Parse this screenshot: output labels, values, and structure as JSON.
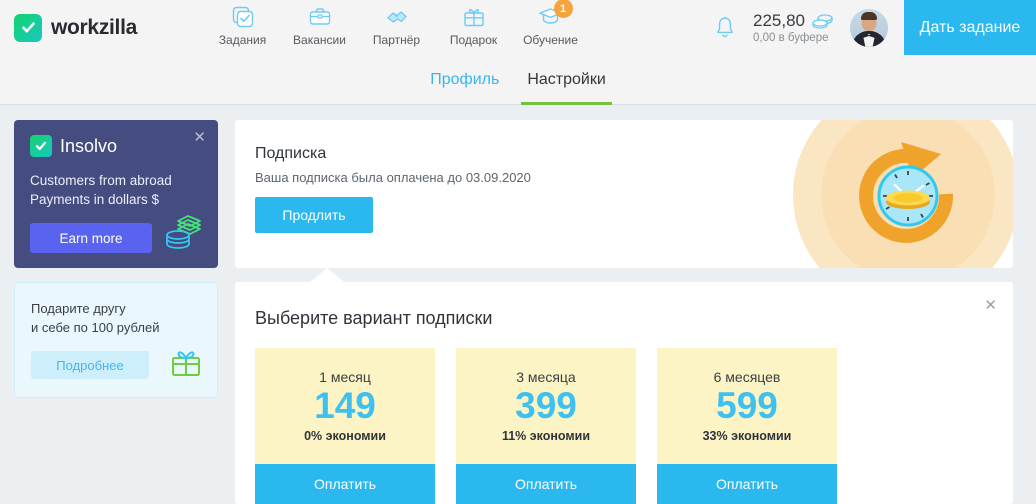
{
  "header": {
    "brand": "workzilla",
    "brand_logo_icon": "check-logo-icon",
    "nav": [
      {
        "label": "Задания",
        "icon": "checkbox-stack-icon",
        "badge": null
      },
      {
        "label": "Вакансии",
        "icon": "briefcase-icon",
        "badge": null
      },
      {
        "label": "Партнёр",
        "icon": "handshake-icon",
        "badge": null
      },
      {
        "label": "Подарок",
        "icon": "gift-icon",
        "badge": null
      },
      {
        "label": "Обучение",
        "icon": "graduation-cap-icon",
        "badge": "1"
      }
    ],
    "bell_icon": "bell-icon",
    "balance_amount": "225,80",
    "balance_icon": "coins-icon",
    "balance_sub": "0,00 в буфере",
    "avatar_alt": "avatar",
    "cta_label": "Дать задание",
    "accent": "#2bb8ee",
    "badge_color": "#f5a33c"
  },
  "tabs": [
    {
      "label": "Профиль",
      "active": false
    },
    {
      "label": "Настройки",
      "active": true
    }
  ],
  "tab_underline_color": "#76c043",
  "sidebar": {
    "insolvo": {
      "logo_icon": "insolvo-check-icon",
      "title": "Insolvo",
      "close_icon": "close-icon",
      "line1": "Customers from abroad",
      "line2": "Payments in dollars $",
      "button_label": "Earn more",
      "coins_icon": "money-stack-icon",
      "bg": "#454c80",
      "button_bg": "#5a63f0"
    },
    "gift": {
      "line1": "Подарите другу",
      "line2": "и себе по 100 рублей",
      "button_label": "Подробнее",
      "gift_icon": "gift-box-icon",
      "bg": "#eaf8fe"
    }
  },
  "subscription": {
    "title": "Подписка",
    "status": "Ваша подписка была оплачена до 03.09.2020",
    "button_label": "Продлить",
    "illustration_icon": "clock-renew-icon"
  },
  "plans_panel": {
    "title": "Выберите вариант подписки",
    "close_icon": "close-icon",
    "plans": [
      {
        "period": "1 месяц",
        "price": "149",
        "saving": "0% экономии",
        "button_label": "Оплатить"
      },
      {
        "period": "3 месяца",
        "price": "399",
        "saving": "11% экономии",
        "button_label": "Оплатить"
      },
      {
        "period": "6 месяцев",
        "price": "599",
        "saving": "33% экономии",
        "button_label": "Оплатить"
      }
    ],
    "card_bg": "#fcf4c5",
    "price_color": "#3ec0f0",
    "button_bg": "#2bb8ee"
  }
}
